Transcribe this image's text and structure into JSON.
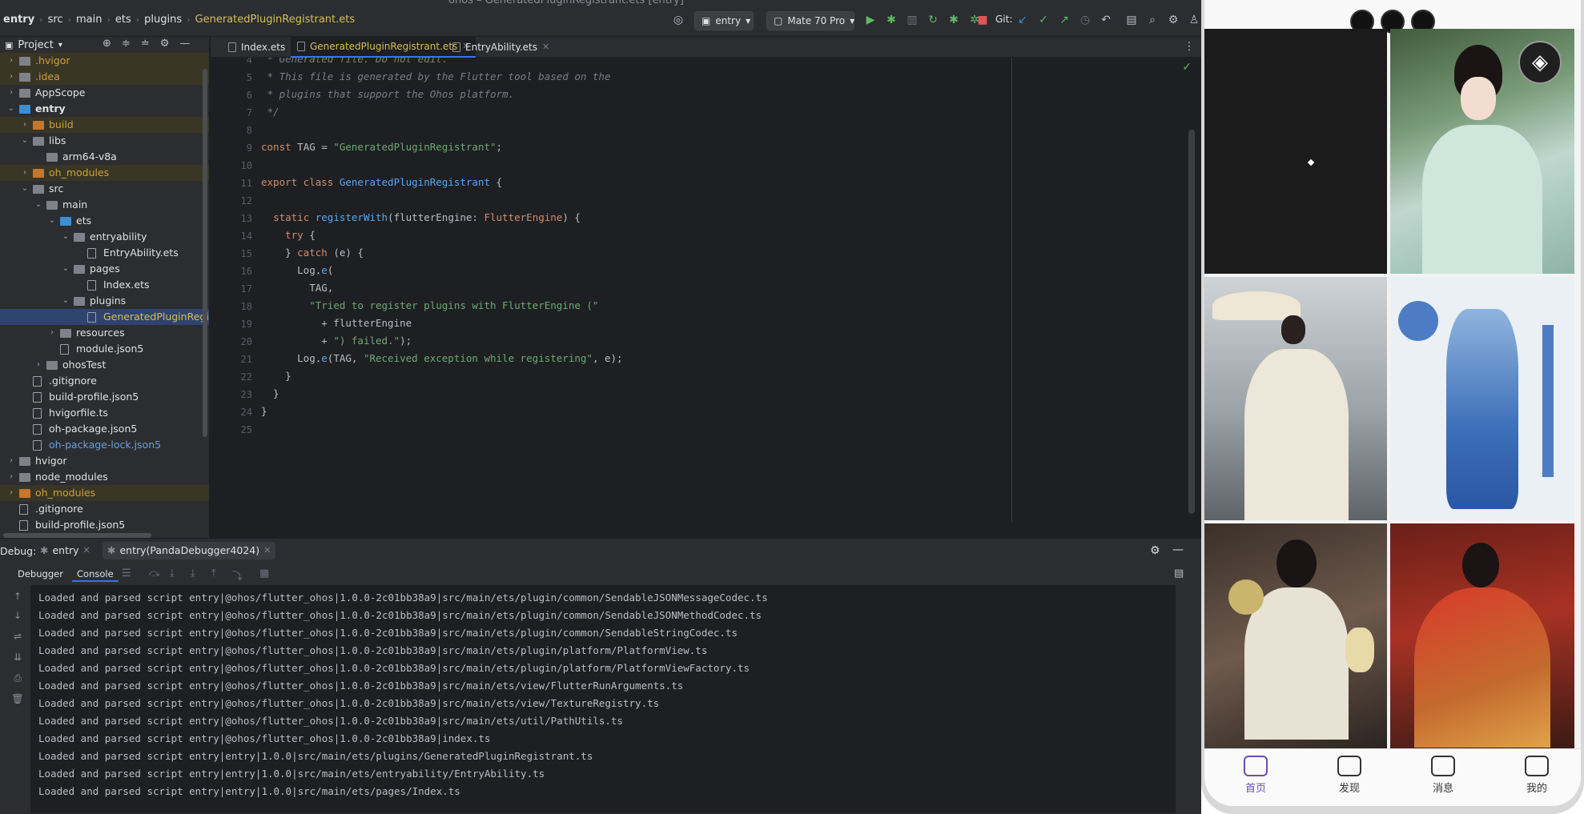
{
  "window": {
    "title": "ohos – GeneratedPluginRegistrant.ets [entry]"
  },
  "breadcrumb": [
    "entry",
    "src",
    "main",
    "ets",
    "plugins",
    "GeneratedPluginRegistrant.ets"
  ],
  "toolbar": {
    "module_select": "entry",
    "device_select": "Mate 70 Pro",
    "git_label": "Git:"
  },
  "project": {
    "title": "Project",
    "tree": [
      {
        "label": ".hvigor",
        "depth": 1,
        "type": "folder",
        "state": "excluded",
        "chev": "›"
      },
      {
        "label": ".idea",
        "depth": 1,
        "type": "folder",
        "state": "excluded",
        "chev": "›"
      },
      {
        "label": "AppScope",
        "depth": 1,
        "type": "folder",
        "state": "",
        "chev": "›"
      },
      {
        "label": "entry",
        "depth": 1,
        "type": "folder-blue",
        "state": "bold",
        "chev": "⌄"
      },
      {
        "label": "build",
        "depth": 2,
        "type": "folder-orange",
        "state": "excluded",
        "chev": "›"
      },
      {
        "label": "libs",
        "depth": 2,
        "type": "folder",
        "state": "",
        "chev": "⌄"
      },
      {
        "label": "arm64-v8a",
        "depth": 3,
        "type": "folder",
        "state": "",
        "chev": ""
      },
      {
        "label": "oh_modules",
        "depth": 2,
        "type": "folder-orange",
        "state": "excluded",
        "chev": "›"
      },
      {
        "label": "src",
        "depth": 2,
        "type": "folder",
        "state": "",
        "chev": "⌄"
      },
      {
        "label": "main",
        "depth": 3,
        "type": "folder",
        "state": "",
        "chev": "⌄"
      },
      {
        "label": "ets",
        "depth": 4,
        "type": "folder-blue",
        "state": "",
        "chev": "⌄"
      },
      {
        "label": "entryability",
        "depth": 5,
        "type": "folder",
        "state": "",
        "chev": "⌄"
      },
      {
        "label": "EntryAbility.ets",
        "depth": 6,
        "type": "file",
        "state": "",
        "chev": ""
      },
      {
        "label": "pages",
        "depth": 5,
        "type": "folder",
        "state": "",
        "chev": "⌄"
      },
      {
        "label": "Index.ets",
        "depth": 6,
        "type": "file",
        "state": "",
        "chev": ""
      },
      {
        "label": "plugins",
        "depth": 5,
        "type": "folder",
        "state": "",
        "chev": "⌄"
      },
      {
        "label": "GeneratedPluginRegistrant.ets",
        "depth": 6,
        "type": "file",
        "state": "selected",
        "chev": ""
      },
      {
        "label": "resources",
        "depth": 4,
        "type": "folder",
        "state": "",
        "chev": "›"
      },
      {
        "label": "module.json5",
        "depth": 4,
        "type": "file",
        "state": "",
        "chev": ""
      },
      {
        "label": "ohosTest",
        "depth": 3,
        "type": "folder",
        "state": "",
        "chev": "›"
      },
      {
        "label": ".gitignore",
        "depth": 2,
        "type": "file",
        "state": "",
        "chev": ""
      },
      {
        "label": "build-profile.json5",
        "depth": 2,
        "type": "file",
        "state": "",
        "chev": ""
      },
      {
        "label": "hvigorfile.ts",
        "depth": 2,
        "type": "file",
        "state": "",
        "chev": ""
      },
      {
        "label": "oh-package.json5",
        "depth": 2,
        "type": "file",
        "state": "",
        "chev": ""
      },
      {
        "label": "oh-package-lock.json5",
        "depth": 2,
        "type": "file",
        "state": "vcs",
        "chev": ""
      },
      {
        "label": "hvigor",
        "depth": 1,
        "type": "folder",
        "state": "",
        "chev": "›"
      },
      {
        "label": "node_modules",
        "depth": 1,
        "type": "folder",
        "state": "",
        "chev": "›"
      },
      {
        "label": "oh_modules",
        "depth": 1,
        "type": "folder-orange",
        "state": "excluded",
        "chev": "›"
      },
      {
        "label": ".gitignore",
        "depth": 1,
        "type": "file",
        "state": "",
        "chev": ""
      },
      {
        "label": "build-profile.json5",
        "depth": 1,
        "type": "file",
        "state": "",
        "chev": ""
      }
    ]
  },
  "editor": {
    "tabs": [
      {
        "label": "Index.ets",
        "active": false
      },
      {
        "label": "GeneratedPluginRegistrant.ets",
        "active": true
      },
      {
        "label": "EntryAbility.ets",
        "active": false
      }
    ],
    "lines": [
      {
        "n": "4",
        "html": "<span class='cm'> * Generated file. Do not edit.</span>"
      },
      {
        "n": "5",
        "html": "<span class='cm'> * This file is generated by the Flutter tool based on the</span>"
      },
      {
        "n": "6",
        "html": "<span class='cm'> * plugins that support the Ohos platform.</span>"
      },
      {
        "n": "7",
        "html": "<span class='cm'> */</span>"
      },
      {
        "n": "8",
        "html": ""
      },
      {
        "n": "9",
        "html": "<span class='kw'>const</span> TAG = <span class='str'>\"GeneratedPluginRegistrant\"</span>;"
      },
      {
        "n": "10",
        "html": ""
      },
      {
        "n": "11",
        "html": "<span class='kw'>export class</span> <span class='cls'>GeneratedPluginRegistrant</span> {"
      },
      {
        "n": "12",
        "html": ""
      },
      {
        "n": "13",
        "html": "  <span class='kw'>static</span> <span class='fn'>registerWith</span>(flutterEngine: <span class='tp'>FlutterEngine</span>) {"
      },
      {
        "n": "14",
        "html": "    <span class='kw'>try</span> {"
      },
      {
        "n": "15",
        "html": "    } <span class='kw'>catch</span> (e) {"
      },
      {
        "n": "16",
        "html": "      Log.<span class='fn'>e</span>("
      },
      {
        "n": "17",
        "html": "        TAG,"
      },
      {
        "n": "18",
        "html": "        <span class='str'>\"Tried to register plugins with FlutterEngine (\"</span>"
      },
      {
        "n": "19",
        "html": "          + flutterEngine"
      },
      {
        "n": "20",
        "html": "          + <span class='str'>\") failed.\"</span>);"
      },
      {
        "n": "21",
        "html": "      Log.<span class='fn'>e</span>(TAG, <span class='str'>\"Received exception while registering\"</span>, e);"
      },
      {
        "n": "22",
        "html": "    }"
      },
      {
        "n": "23",
        "html": "  }"
      },
      {
        "n": "24",
        "html": "}"
      },
      {
        "n": "25",
        "html": ""
      }
    ]
  },
  "debug": {
    "label": "Debug:",
    "tabs": [
      {
        "label": "entry",
        "active": false
      },
      {
        "label": "entry(PandaDebugger4024)",
        "active": true
      }
    ],
    "subtabs": [
      {
        "label": "Debugger",
        "active": false
      },
      {
        "label": "Console",
        "active": true
      }
    ],
    "console_lines": [
      "Loaded and parsed script entry|@ohos/flutter_ohos|1.0.0-2c01bb38a9|src/main/ets/plugin/common/SendableJSONMessageCodec.ts",
      "Loaded and parsed script entry|@ohos/flutter_ohos|1.0.0-2c01bb38a9|src/main/ets/plugin/common/SendableJSONMethodCodec.ts",
      "Loaded and parsed script entry|@ohos/flutter_ohos|1.0.0-2c01bb38a9|src/main/ets/plugin/common/SendableStringCodec.ts",
      "Loaded and parsed script entry|@ohos/flutter_ohos|1.0.0-2c01bb38a9|src/main/ets/plugin/platform/PlatformView.ts",
      "Loaded and parsed script entry|@ohos/flutter_ohos|1.0.0-2c01bb38a9|src/main/ets/plugin/platform/PlatformViewFactory.ts",
      "Loaded and parsed script entry|@ohos/flutter_ohos|1.0.0-2c01bb38a9|src/main/ets/view/FlutterRunArguments.ts",
      "Loaded and parsed script entry|@ohos/flutter_ohos|1.0.0-2c01bb38a9|src/main/ets/view/TextureRegistry.ts",
      "Loaded and parsed script entry|@ohos/flutter_ohos|1.0.0-2c01bb38a9|src/main/ets/util/PathUtils.ts",
      "Loaded and parsed script entry|@ohos/flutter_ohos|1.0.0-2c01bb38a9|index.ts",
      "Loaded and parsed script entry|entry|1.0.0|src/main/ets/plugins/GeneratedPluginRegistrant.ts",
      "Loaded and parsed script entry|entry|1.0.0|src/main/ets/entryability/EntryAbility.ts",
      "Loaded and parsed script entry|entry|1.0.0|src/main/ets/pages/Index.ts"
    ]
  },
  "phone": {
    "nav": [
      {
        "label": "首页",
        "active": true,
        "icon": "home-icon"
      },
      {
        "label": "发现",
        "active": false,
        "icon": "discover-icon"
      },
      {
        "label": "消息",
        "active": false,
        "icon": "message-icon"
      },
      {
        "label": "我的",
        "active": false,
        "icon": "profile-icon"
      }
    ],
    "colors": {
      "accent": "#6b4fa8"
    }
  }
}
